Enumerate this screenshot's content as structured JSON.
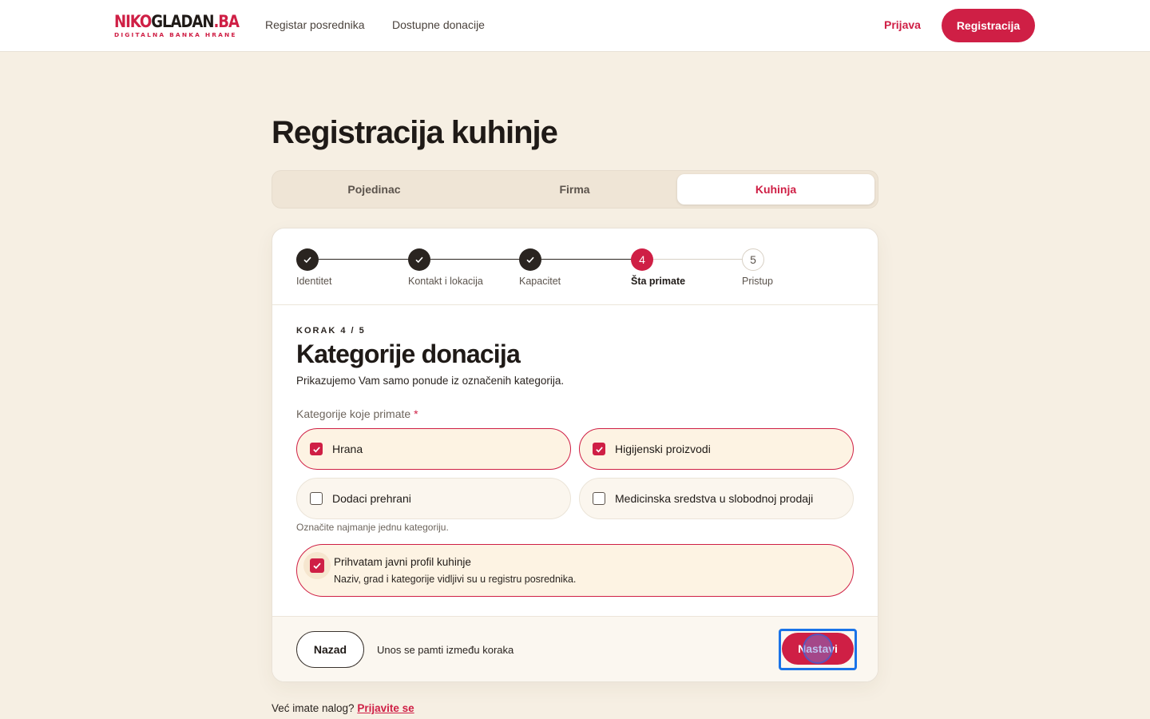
{
  "header": {
    "logo_main_a": "NIKO",
    "logo_main_b": "GLADAN",
    "logo_main_c": ".BA",
    "logo_sub": "DIGITALNA BANKA HRANE",
    "nav": [
      "Registar posrednika",
      "Dostupne donacije"
    ],
    "login": "Prijava",
    "register": "Registracija"
  },
  "page": {
    "title": "Registracija kuhinje",
    "tabs": [
      "Pojedinac",
      "Firma",
      "Kuhinja"
    ],
    "active_tab": "Kuhinja"
  },
  "stepper": {
    "steps": [
      {
        "num": "1",
        "label": "Identitet",
        "state": "done"
      },
      {
        "num": "2",
        "label": "Kontakt i lokacija",
        "state": "done"
      },
      {
        "num": "3",
        "label": "Kapacitet",
        "state": "done"
      },
      {
        "num": "4",
        "label": "Šta primate",
        "state": "active"
      },
      {
        "num": "5",
        "label": "Pristup",
        "state": "todo"
      }
    ]
  },
  "form": {
    "kicker": "KORAK 4 / 5",
    "title": "Kategorije donacija",
    "description": "Prikazujemo Vam samo ponude iz označenih kategorija.",
    "field_label": "Kategorije koje primate",
    "required_mark": "*",
    "options": [
      {
        "label": "Hrana",
        "checked": true
      },
      {
        "label": "Higijenski proizvodi",
        "checked": true
      },
      {
        "label": "Dodaci prehrani",
        "checked": false
      },
      {
        "label": "Medicinska sredstva u slobodnoj prodaji",
        "checked": false
      }
    ],
    "hint": "Označite najmanje jednu kategoriju.",
    "consent": {
      "title": "Prihvatam javni profil kuhinje",
      "description": "Naziv, grad i kategorije vidljivi su u registru posrednika.",
      "checked": true
    }
  },
  "footer": {
    "back": "Nazad",
    "note": "Unos se pamti između koraka",
    "next": "Nastavi"
  },
  "bottom": {
    "text": "Već imate nalog?",
    "link": "Prijavite se"
  },
  "colors": {
    "brand": "#cf1f45",
    "background": "#f6efe3",
    "dark": "#2a2420"
  }
}
